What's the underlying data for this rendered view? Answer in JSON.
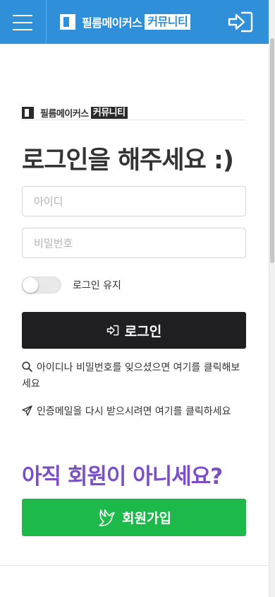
{
  "header": {
    "brand_name": "필름메이커스",
    "brand_tag": "커뮤니티",
    "icons": {
      "menu": "hamburger-menu-icon",
      "login": "sign-in-icon"
    },
    "background_color": "#2f8fd8"
  },
  "login_panel": {
    "mini_brand_name": "필름메이커스",
    "mini_brand_tag": "커뮤니티",
    "heading": "로그인을 해주세요 :)",
    "id_placeholder": "아이디",
    "password_placeholder": "비밀번호",
    "keep_login_label": "로그인 유지",
    "keep_login_enabled": false,
    "login_button_label": "로그인",
    "help_find_account": "아이디나 비밀번호를 잊으셨으면 여기를 클릭해보세요",
    "help_resend_email": "인증메일을 다시 받으시려면 여기를 클릭하세요",
    "not_member_text": "아직 회원이 아니세요?",
    "join_button_label": "회원가입"
  },
  "colors": {
    "login_button": "#1f1f21",
    "join_button": "#1db94a",
    "not_member_text": "#7a4fc8"
  }
}
